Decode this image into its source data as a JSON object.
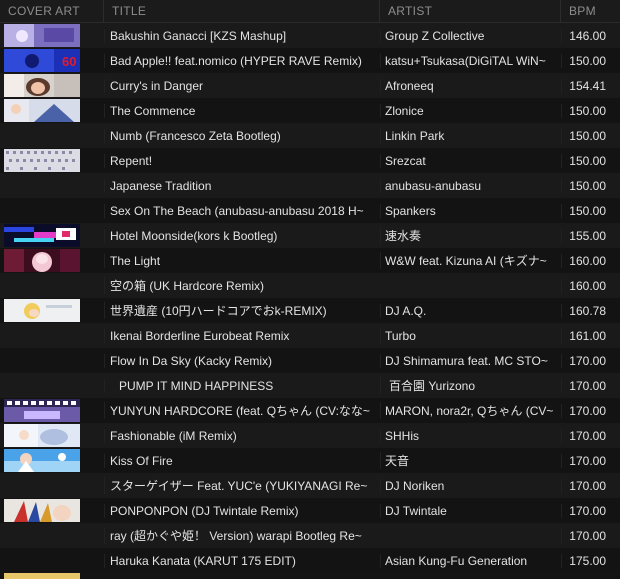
{
  "headers": {
    "cover": "COVER ART",
    "title": "TITLE",
    "artist": "ARTIST",
    "bpm": "BPM"
  },
  "rows": [
    {
      "title": "Bakushin Ganacci [KZS Mashup]",
      "artist": "Group Z Collective",
      "bpm": "146.00",
      "cover": "purple"
    },
    {
      "title": "Bad Apple!! feat.nomico (HYPER RAVE Remix)",
      "artist": "katsu+Tsukasa(DiGiTAL WiN~",
      "bpm": "150.00",
      "cover": "blue60"
    },
    {
      "title": "Curry's in Danger",
      "artist": "Afroneeq",
      "bpm": "154.41",
      "cover": "girl"
    },
    {
      "title": "The Commence",
      "artist": "Zlonice",
      "bpm": "150.00",
      "cover": "anime"
    },
    {
      "title": "Numb (Francesco Zeta Bootleg)",
      "artist": "Linkin Park",
      "bpm": "150.00",
      "cover": ""
    },
    {
      "title": "Repent!",
      "artist": "Srezcat",
      "bpm": "150.00",
      "cover": "grid"
    },
    {
      "title": "Japanese Tradition",
      "artist": "anubasu-anubasu",
      "bpm": "150.00",
      "cover": ""
    },
    {
      "title": "Sex On The Beach (anubasu-anubasu 2018 H~",
      "artist": "Spankers",
      "bpm": "150.00",
      "cover": ""
    },
    {
      "title": "Hotel Moonside(kors k Bootleg)",
      "artist": "速水奏",
      "bpm": "155.00",
      "cover": "glitch"
    },
    {
      "title": "The Light",
      "artist": "W&W feat. Kizuna AI (キズナ~",
      "bpm": "160.00",
      "cover": "pink"
    },
    {
      "title": "空の箱 (UK Hardcore Remix)",
      "artist": "",
      "bpm": "160.00",
      "cover": ""
    },
    {
      "title": "世界遺産 (10円ハードコアでおk-REMIX)",
      "artist": "DJ A.Q.",
      "bpm": "160.78",
      "cover": "white"
    },
    {
      "title": "Ikenai Borderline Eurobeat Remix",
      "artist": "Turbo",
      "bpm": "161.00",
      "cover": ""
    },
    {
      "title": "Flow In Da Sky (Kacky Remix)",
      "artist": "DJ Shimamura feat. MC STO~",
      "bpm": "170.00",
      "cover": ""
    },
    {
      "title": "PUMP IT MIND HAPPINESS",
      "artist": "百合園 Yurizono",
      "bpm": "170.00",
      "cover": "",
      "indent": true
    },
    {
      "title": "YUNYUN HARDCORE (feat. Qちゃん (CV:なな~",
      "artist": "MARON, nora2r, Qちゃん (CV~",
      "bpm": "170.00",
      "cover": "yunyun"
    },
    {
      "title": "Fashionable (iM Remix)",
      "artist": "SHHis",
      "bpm": "170.00",
      "cover": "light"
    },
    {
      "title": "Kiss Of Fire",
      "artist": "天音",
      "bpm": "170.00",
      "cover": "sky"
    },
    {
      "title": "スターゲイザー Feat. YUC'e (YUKIYANAGI Re~",
      "artist": "DJ Noriken",
      "bpm": "170.00",
      "cover": ""
    },
    {
      "title": "PONPONPON (DJ Twintale Remix)",
      "artist": "DJ Twintale",
      "bpm": "170.00",
      "cover": "feather"
    },
    {
      "title": "ray (超かぐや姫！ Version) warapi Bootleg Re~",
      "artist": "",
      "bpm": "170.00",
      "cover": ""
    },
    {
      "title": "Haruka Kanata (KARUT 175 EDIT)",
      "artist": "Asian Kung-Fu Generation",
      "bpm": "175.00",
      "cover": ""
    }
  ]
}
